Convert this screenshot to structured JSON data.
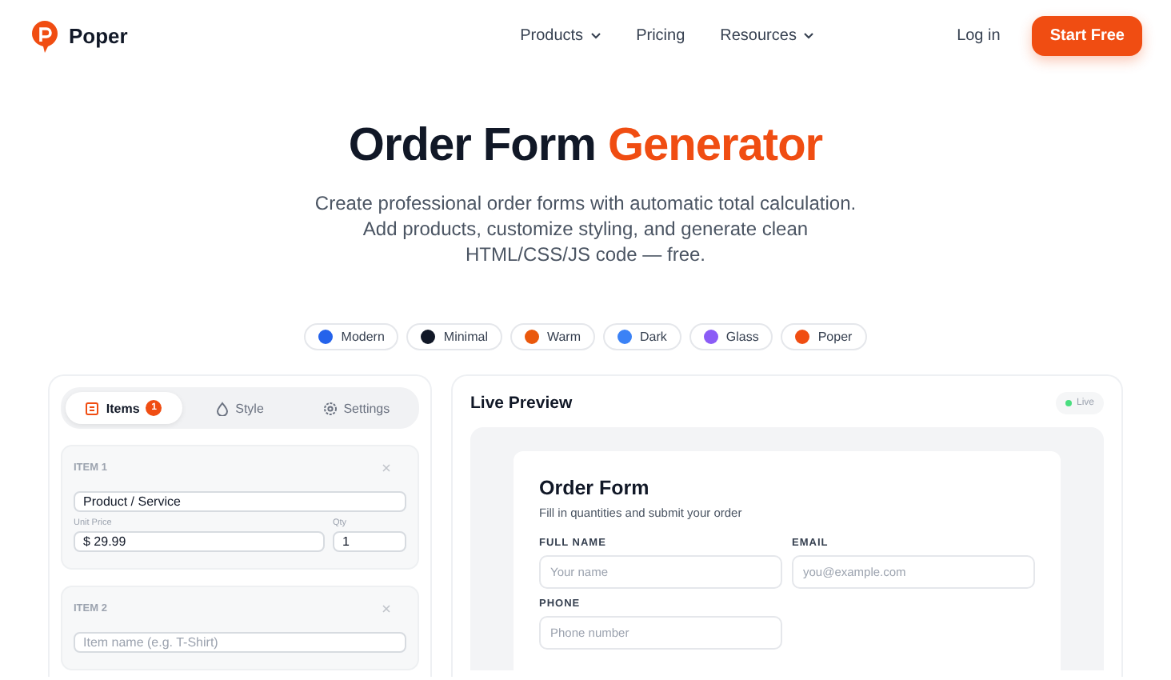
{
  "nav": {
    "brand": "Poper",
    "links": [
      {
        "label": "Products",
        "dropdown": true
      },
      {
        "label": "Pricing",
        "dropdown": false
      },
      {
        "label": "Resources",
        "dropdown": true
      }
    ],
    "login": "Log in",
    "cta": "Start Free"
  },
  "hero": {
    "title": "Order Form ",
    "title_accent": "Generator",
    "subtitle": "Create professional order forms with automatic total calculation. Add products, customize styling, and generate clean HTML/CSS/JS code — free."
  },
  "themes": [
    {
      "label": "Modern",
      "color": "#2563eb"
    },
    {
      "label": "Minimal",
      "color": "#111827"
    },
    {
      "label": "Warm",
      "color": "#ea580c"
    },
    {
      "label": "Dark",
      "color": "#3b82f6"
    },
    {
      "label": "Glass",
      "color": "#8b5cf6"
    },
    {
      "label": "Poper",
      "color": "#f04d12"
    }
  ],
  "editor": {
    "tabs": [
      {
        "label": "Items",
        "badge": "1",
        "selected": true,
        "kind": "items"
      },
      {
        "label": "Style",
        "selected": false,
        "kind": "style"
      },
      {
        "label": "Settings",
        "selected": false,
        "kind": "settings"
      }
    ],
    "items": [
      {
        "heading": "ITEM 1",
        "name": "Product / Service",
        "price_label": "Unit Price",
        "price": "$ 29.99",
        "qty_label": "Qty",
        "qty": "1"
      },
      {
        "heading": "ITEM 2",
        "name_placeholder": "Item name (e.g. T-Shirt)"
      }
    ]
  },
  "preview": {
    "title": "Live Preview",
    "badge": "Live",
    "form": {
      "title": "Order Form",
      "subtitle": "Fill in quantities and submit your order",
      "fields": [
        {
          "label": "FULL NAME",
          "placeholder": "Your name"
        },
        {
          "label": "EMAIL",
          "placeholder": "you@example.com"
        },
        {
          "label": "PHONE",
          "placeholder": "Phone number"
        }
      ]
    }
  }
}
